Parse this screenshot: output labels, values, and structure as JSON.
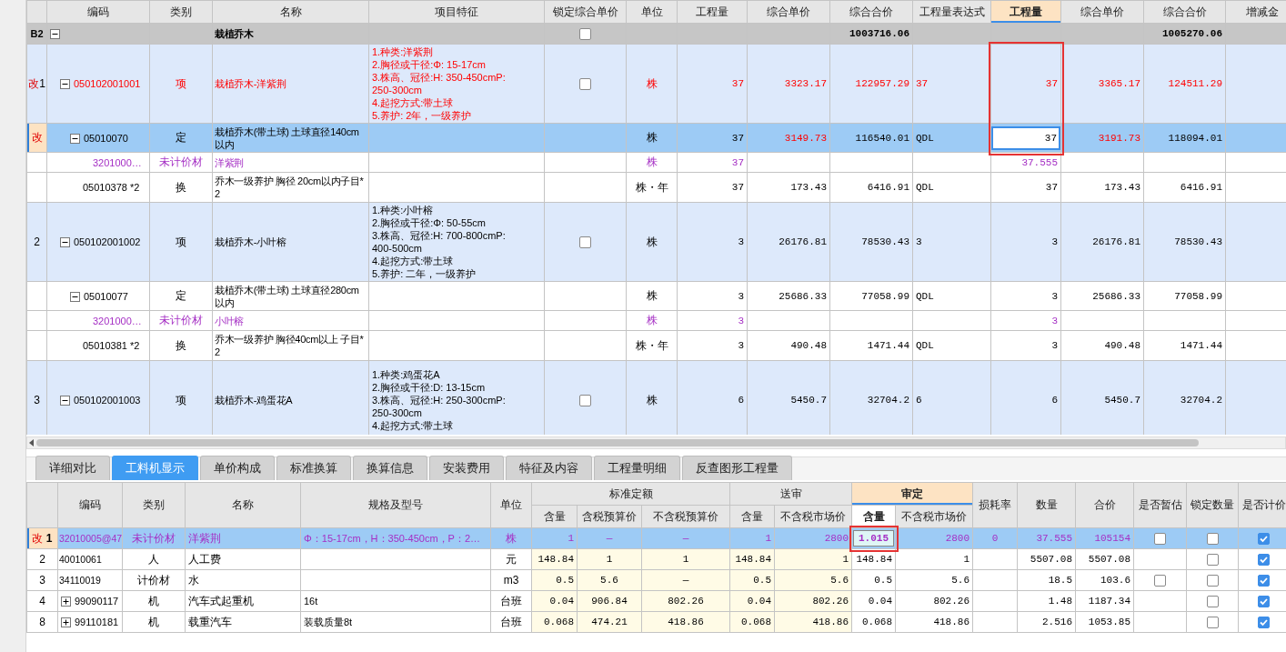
{
  "top_table": {
    "columns": [
      {
        "label": "编码",
        "active": false
      },
      {
        "label": "类别",
        "active": false
      },
      {
        "label": "名称",
        "active": false
      },
      {
        "label": "项目特征",
        "active": false
      },
      {
        "label": "锁定综合单价",
        "active": false
      },
      {
        "label": "单位",
        "active": false
      },
      {
        "label": "工程量",
        "active": false
      },
      {
        "label": "综合单价",
        "active": false
      },
      {
        "label": "综合合价",
        "active": false
      },
      {
        "label": "工程量表达式",
        "active": false
      },
      {
        "label": "工程量",
        "active": true
      },
      {
        "label": "综合单价",
        "active": false
      },
      {
        "label": "综合合价",
        "active": false
      },
      {
        "label": "增减金",
        "active": false
      }
    ],
    "rows": [
      {
        "kind": "section",
        "marker": {
          "label": "B2"
        },
        "expanded": true,
        "name": "栽植乔木",
        "locked": false,
        "total": "1003716.06",
        "a_total": "1005270.06",
        "selected": false,
        "children": [
          {
            "kind": "item",
            "marker": {
              "flag": "改",
              "number": "1",
              "current": false
            },
            "modified": true,
            "expanded": true,
            "code": "050102001001",
            "category": "项",
            "name": "栽植乔木-洋紫荆",
            "features": [
              "1.种类:洋紫荆",
              "2.胸径或干径:Φ: 15-17cm",
              "3.株高、冠径:H: 350-450cmP:",
              "250-300cm",
              "4.起挖方式:带土球",
              "5.养护: 2年，一级养护"
            ],
            "locked": false,
            "unit": "株",
            "qty": "37",
            "unit_price": "3323.17",
            "total": "122957.29",
            "expr": "37",
            "a_qty": "37",
            "a_unit_price": "3365.17",
            "a_total": "124511.29",
            "callout": true,
            "selected": false,
            "children": [
              {
                "kind": "quota",
                "marker": {
                  "flag": "改",
                  "current": true
                },
                "selected": true,
                "price_changed": true,
                "expanded": true,
                "code": "05010070",
                "category": "定",
                "name": "栽植乔木(带土球) 土球直径140cm以内",
                "unit": "株",
                "qty": "37",
                "unit_price": "3149.73",
                "total": "116540.01",
                "expr": "QDL",
                "a_qty": "37",
                "a_unit_price": "3191.73",
                "a_total": "118094.01",
                "callout": true,
                "editing": true,
                "children": [
                  {
                    "kind": "material",
                    "code": "3201000…",
                    "category": "未计价材",
                    "name": "洋紫荆",
                    "unit": "株",
                    "qty": "37",
                    "a_qty": "37.555",
                    "selected": false
                  }
                ]
              },
              {
                "kind": "conversion",
                "code": "05010378 *2",
                "category": "换",
                "name": "乔木一级养护 胸径 20cm以内子目*2",
                "unit": "株・年",
                "qty": "37",
                "unit_price": "173.43",
                "total": "6416.91",
                "expr": "QDL",
                "a_qty": "37",
                "a_unit_price": "173.43",
                "a_total": "6416.91",
                "selected": false
              }
            ]
          },
          {
            "kind": "item",
            "marker": {
              "number": "2"
            },
            "expanded": true,
            "code": "050102001002",
            "category": "项",
            "name": "栽植乔木-小叶榕",
            "features": [
              "1.种类:小叶榕",
              "2.胸径或干径:Φ: 50-55cm",
              "3.株高、冠径:H: 700-800cmP:",
              "400-500cm",
              "4.起挖方式:带土球",
              "5.养护: 二年，一级养护"
            ],
            "locked": false,
            "unit": "株",
            "qty": "3",
            "unit_price": "26176.81",
            "total": "78530.43",
            "expr": "3",
            "a_qty": "3",
            "a_unit_price": "26176.81",
            "a_total": "78530.43",
            "selected": false,
            "children": [
              {
                "kind": "quota",
                "expanded": true,
                "code": "05010077",
                "category": "定",
                "name": "栽植乔木(带土球) 土球直径280cm以内",
                "unit": "株",
                "qty": "3",
                "unit_price": "25686.33",
                "total": "77058.99",
                "expr": "QDL",
                "a_qty": "3",
                "a_unit_price": "25686.33",
                "a_total": "77058.99",
                "selected": false,
                "children": [
                  {
                    "kind": "material",
                    "code": "3201000…",
                    "category": "未计价材",
                    "name": "小叶榕",
                    "unit": "株",
                    "qty": "3",
                    "a_qty": "3",
                    "selected": false
                  }
                ]
              },
              {
                "kind": "conversion",
                "code": "05010381 *2",
                "category": "换",
                "name": "乔木一级养护 胸径40cm以上 子目*2",
                "unit": "株・年",
                "qty": "3",
                "unit_price": "490.48",
                "total": "1471.44",
                "expr": "QDL",
                "a_qty": "3",
                "a_unit_price": "490.48",
                "a_total": "1471.44",
                "selected": false
              }
            ]
          },
          {
            "kind": "item",
            "marker": {
              "number": "3"
            },
            "expanded": true,
            "code": "050102001003",
            "category": "项",
            "name": "栽植乔木-鸡蛋花A",
            "features": [
              "1.种类:鸡蛋花A",
              "2.胸径或干径:D: 13-15cm",
              "3.株高、冠径:H: 250-300cmP:",
              "250-300cm",
              "4.起挖方式:带土球"
            ],
            "locked": false,
            "unit": "株",
            "qty": "6",
            "unit_price": "5450.7",
            "total": "32704.2",
            "expr": "6",
            "a_qty": "6",
            "a_unit_price": "5450.7",
            "a_total": "32704.2",
            "selected": false
          }
        ]
      }
    ]
  },
  "tabs": [
    {
      "label": "详细对比",
      "selected": false
    },
    {
      "label": "工料机显示",
      "selected": true
    },
    {
      "label": "单价构成",
      "selected": false
    },
    {
      "label": "标准换算",
      "selected": false
    },
    {
      "label": "换算信息",
      "selected": false
    },
    {
      "label": "安装费用",
      "selected": false
    },
    {
      "label": "特征及内容",
      "selected": false
    },
    {
      "label": "工程量明细",
      "selected": false
    },
    {
      "label": "反查图形工程量",
      "selected": false
    }
  ],
  "bottom_table": {
    "columns": [
      {
        "label": "编码"
      },
      {
        "label": "类别"
      },
      {
        "label": "名称"
      },
      {
        "label": "规格及型号"
      },
      {
        "label": "单位"
      },
      {
        "label": "标准定额",
        "active": false,
        "columns": [
          {
            "label": "含量",
            "active": false
          },
          {
            "label": "含税预算价",
            "active": false
          },
          {
            "label": "不含税预算价",
            "active": false
          }
        ]
      },
      {
        "label": "送审",
        "active": false,
        "columns": [
          {
            "label": "含量",
            "active": false
          },
          {
            "label": "不含税市场价",
            "active": false
          }
        ]
      },
      {
        "label": "审定",
        "active": true,
        "columns": [
          {
            "label": "含量",
            "active": true
          },
          {
            "label": "不含税市场价",
            "active": false
          }
        ]
      },
      {
        "label": "损耗率"
      },
      {
        "label": "数量"
      },
      {
        "label": "合价"
      },
      {
        "label": "是否暂估"
      },
      {
        "label": "锁定数量"
      },
      {
        "label": "是否计价"
      }
    ],
    "rows": [
      {
        "kind": "material",
        "marker": {
          "flag": "改",
          "number": "1",
          "current": true
        },
        "selected": true,
        "code": "32010005@47",
        "category": "未计价材",
        "name": "洋紫荆",
        "spec": "Φ：15-17cm，H：350-450cm，P：2…",
        "unit": "株",
        "std_qty": "1",
        "std_tax_price": "—",
        "std_notax_price": "—",
        "sub_qty": "1",
        "sub_price": "2800",
        "apr_qty": "1.015",
        "apr_price": "2800",
        "loss_rate": "0",
        "quantity": "37.555",
        "total": "105154",
        "provisional": false,
        "lock_qty": false,
        "priced": true,
        "editing": true,
        "callout": true
      },
      {
        "kind": "labor",
        "marker": {
          "number": "2"
        },
        "selected": false,
        "code": "40010061",
        "category": "人",
        "name": "人工费",
        "unit": "元",
        "std_qty": "148.84",
        "std_tax_price": "1",
        "std_notax_price": "1",
        "sub_qty": "148.84",
        "sub_price": "1",
        "apr_qty": "148.84",
        "apr_price": "1",
        "quantity": "5507.08",
        "total": "5507.08",
        "lock_qty": false,
        "priced": true
      },
      {
        "kind": "material",
        "marker": {
          "number": "3"
        },
        "selected": false,
        "code": "34110019",
        "category": "计价材",
        "name": "水",
        "unit": "m3",
        "std_qty": "0.5",
        "std_tax_price": "5.6",
        "std_notax_price": "—",
        "sub_qty": "0.5",
        "sub_price": "5.6",
        "apr_qty": "0.5",
        "apr_price": "5.6",
        "quantity": "18.5",
        "total": "103.6",
        "provisional": false,
        "lock_qty": false,
        "priced": true
      },
      {
        "kind": "machine",
        "marker": {
          "number": "4"
        },
        "selected": false,
        "expanded": false,
        "code": "99090117",
        "category": "机",
        "name": "汽车式起重机",
        "spec": "16t",
        "unit": "台班",
        "std_qty": "0.04",
        "std_tax_price": "906.84",
        "std_notax_price": "802.26",
        "sub_qty": "0.04",
        "sub_price": "802.26",
        "apr_qty": "0.04",
        "apr_price": "802.26",
        "quantity": "1.48",
        "total": "1187.34",
        "lock_qty": false,
        "priced": true
      },
      {
        "kind": "machine",
        "marker": {
          "number": "8"
        },
        "selected": false,
        "expanded": false,
        "code": "99110181",
        "category": "机",
        "name": "载重汽车",
        "spec": "装载质量8t",
        "unit": "台班",
        "std_qty": "0.068",
        "std_tax_price": "474.21",
        "std_notax_price": "418.86",
        "sub_qty": "0.068",
        "sub_price": "418.86",
        "apr_qty": "0.068",
        "apr_price": "418.86",
        "quantity": "2.516",
        "total": "1053.85",
        "lock_qty": false,
        "priced": true
      }
    ]
  }
}
